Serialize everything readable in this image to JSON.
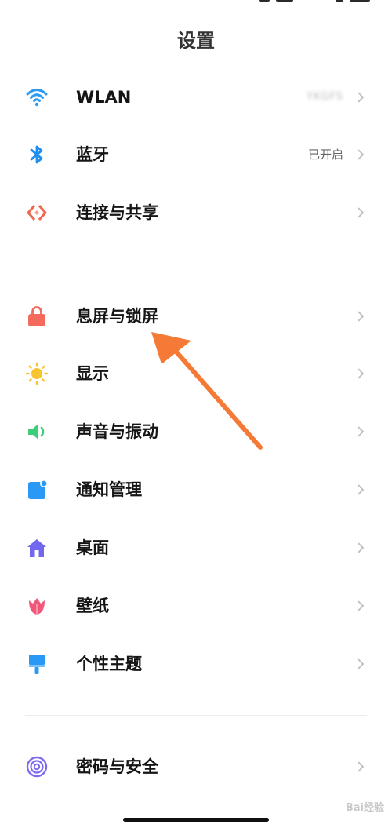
{
  "page": {
    "title": "设置"
  },
  "settings": {
    "group1": [
      {
        "id": "wlan",
        "label": "WLAN",
        "value": "YKGFS",
        "icon": "wifi-icon",
        "icon_color": "#2b9bf4"
      },
      {
        "id": "bluetooth",
        "label": "蓝牙",
        "value": "已开启",
        "icon": "bluetooth-icon",
        "icon_color": "#1e8ef0"
      },
      {
        "id": "connection-sharing",
        "label": "连接与共享",
        "value": "",
        "icon": "connection-icon",
        "icon_color": "#f0674e"
      }
    ],
    "group2": [
      {
        "id": "lock-screen",
        "label": "息屏与锁屏",
        "value": "",
        "icon": "lock-icon",
        "icon_color": "#f46b5d"
      },
      {
        "id": "display",
        "label": "显示",
        "value": "",
        "icon": "sun-icon",
        "icon_color": "#f7c531"
      },
      {
        "id": "sound-vibration",
        "label": "声音与振动",
        "value": "",
        "icon": "speaker-icon",
        "icon_color": "#3dcc7a"
      },
      {
        "id": "notifications",
        "label": "通知管理",
        "value": "",
        "icon": "notification-icon",
        "icon_color": "#2a98f5"
      },
      {
        "id": "desktop",
        "label": "桌面",
        "value": "",
        "icon": "home-icon",
        "icon_color": "#7268f0"
      },
      {
        "id": "wallpaper",
        "label": "壁纸",
        "value": "",
        "icon": "flower-icon",
        "icon_color": "#f0577b"
      },
      {
        "id": "themes",
        "label": "个性主题",
        "value": "",
        "icon": "brush-icon",
        "icon_color": "#2a98f5"
      }
    ],
    "group3": [
      {
        "id": "password-security",
        "label": "密码与安全",
        "value": "",
        "icon": "fingerprint-icon",
        "icon_color": "#7c6cf0"
      }
    ]
  },
  "annotation": {
    "arrow_color": "#f57a35"
  },
  "watermark": {
    "text": "Bai经验"
  }
}
